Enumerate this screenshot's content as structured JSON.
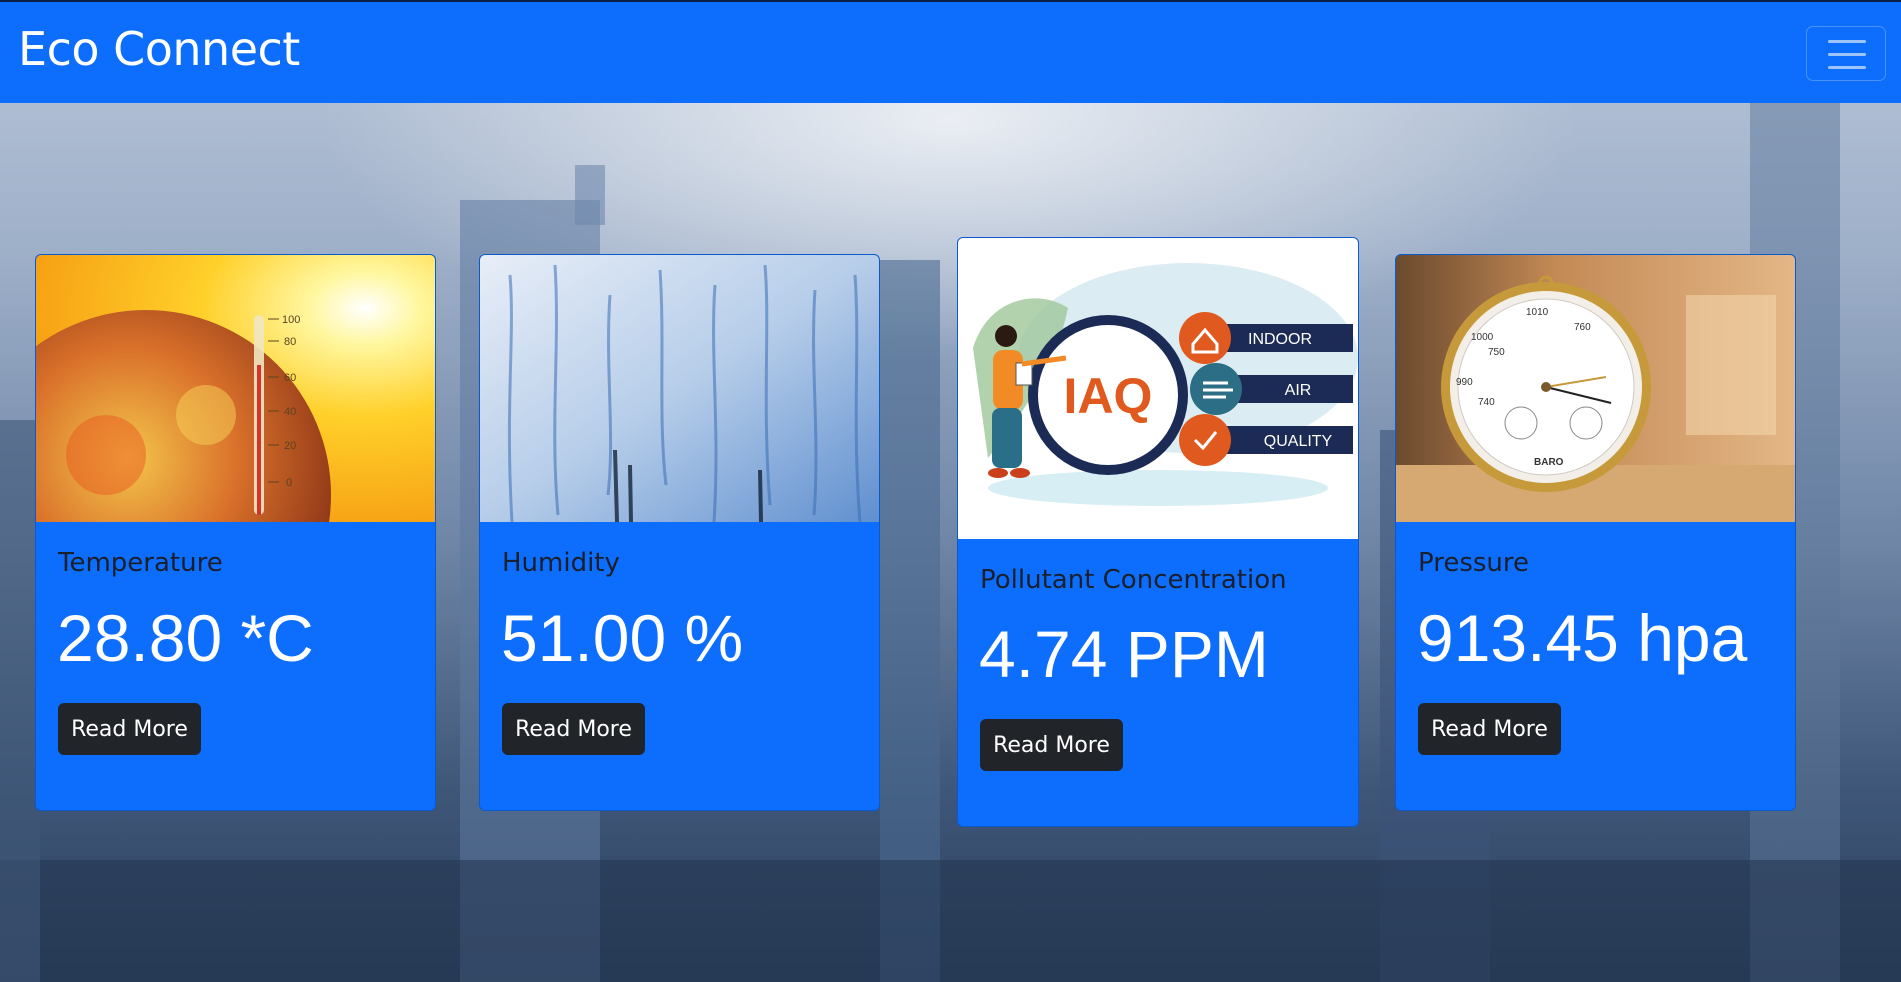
{
  "navbar": {
    "brand": "Eco Connect",
    "toggle_icon": "hamburger-menu-icon"
  },
  "cards": [
    {
      "id": "temperature",
      "image_icon": "hot-globe-thermometer-image",
      "title": "Temperature",
      "value": "28.80 *C",
      "button": "Read More"
    },
    {
      "id": "humidity",
      "image_icon": "condensation-glass-image",
      "title": "Humidity",
      "value": "51.00 %",
      "button": "Read More"
    },
    {
      "id": "pollutant",
      "image_icon": "iaq-illustration-image",
      "title": "Pollutant Concentration",
      "value": "4.74 PPM",
      "button": "Read More",
      "illustration": {
        "logo": "IAQ",
        "labels": [
          "INDOOR",
          "AIR",
          "QUALITY"
        ]
      }
    },
    {
      "id": "pressure",
      "image_icon": "barometer-image",
      "title": "Pressure",
      "value": "913.45 hpa",
      "button": "Read More",
      "barometer": {
        "scale_marks": [
          "1010",
          "1000",
          "990",
          "760",
          "750",
          "740"
        ],
        "label": "BARO"
      }
    }
  ],
  "colors": {
    "primary": "#0d6efd",
    "button_dark": "#212529",
    "title_text": "#1a1f2c"
  }
}
